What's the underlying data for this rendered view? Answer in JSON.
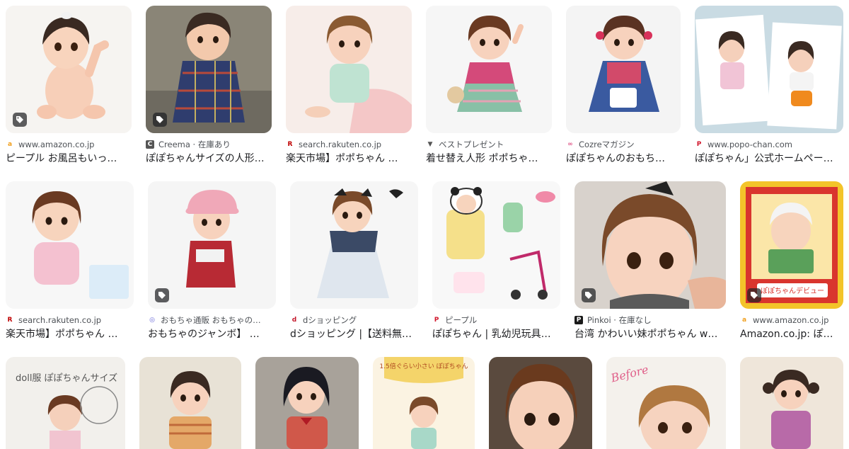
{
  "colors": {
    "amazon": "#f0a020",
    "rakuten": "#bf0000",
    "popo": "#d1172c",
    "pinkoi": "#1a1a1a",
    "creema": "#555555",
    "cozre": "#e05a8a",
    "gift": "#555555",
    "jumbo": "#6a6ad8",
    "dshop": "#c4162a"
  },
  "row1": [
    {
      "source": "www.amazon.co.jp",
      "favicon": "amazon-icon",
      "title": "ピープル お風呂もいっ…",
      "tag": true
    },
    {
      "source": "Creema · 在庫あり",
      "favicon": "creema-icon",
      "title": "ぽぽちゃんサイズの人形…",
      "tag": true
    },
    {
      "source": "search.rakuten.co.jp",
      "favicon": "rakuten-icon",
      "title": "楽天市場】ポポちゃん …",
      "tag": false
    },
    {
      "source": "ベストプレゼント",
      "favicon": "gift-icon",
      "title": "着せ替え人形 ポポちゃ…",
      "tag": false
    },
    {
      "source": "Cozreマガジン",
      "favicon": "cozre-icon",
      "title": "ぽぽちゃんのおもち…",
      "tag": false
    },
    {
      "source": "www.popo-chan.com",
      "favicon": "popo-chan-icon",
      "title": "ぽぽちゃん」公式ホームペー…",
      "tag": false
    }
  ],
  "row2": [
    {
      "source": "search.rakuten.co.jp",
      "favicon": "rakuten-icon",
      "title": "楽天市場】ポポちゃん …",
      "tag": false
    },
    {
      "source": "おもちゃ通販 おもちゃの…",
      "favicon": "jumbo-icon",
      "title": "おもちゃのジャンボ】 …",
      "tag": true
    },
    {
      "source": "dショッピング",
      "favicon": "dshop-icon",
      "title": "dショッピング |【送料無…",
      "tag": false
    },
    {
      "source": "ピープル",
      "favicon": "people-icon",
      "title": "ぽぽちゃん | 乳幼児玩具…",
      "tag": false
    },
    {
      "source": "Pinkoi · 在庫なし",
      "favicon": "pinkoi-icon",
      "title": "台湾 かわいい妹ポポちゃん w…",
      "tag": true
    },
    {
      "source": "www.amazon.co.jp",
      "favicon": "amazon-icon",
      "title": "Amazon.co.jp: ぽ…",
      "tag": true
    }
  ],
  "row3": [
    {
      "overlay": "doll服 ぽぽちゃんサイズ"
    },
    {
      "overlay": ""
    },
    {
      "overlay": ""
    },
    {
      "overlay": "1.5倍ぐらい小さい ぽぽちゃん"
    },
    {
      "overlay": ""
    },
    {
      "overlay": "Before"
    },
    {
      "overlay": ""
    }
  ],
  "box_labels": {
    "brand": "ぽぽちゃんデビュー"
  }
}
